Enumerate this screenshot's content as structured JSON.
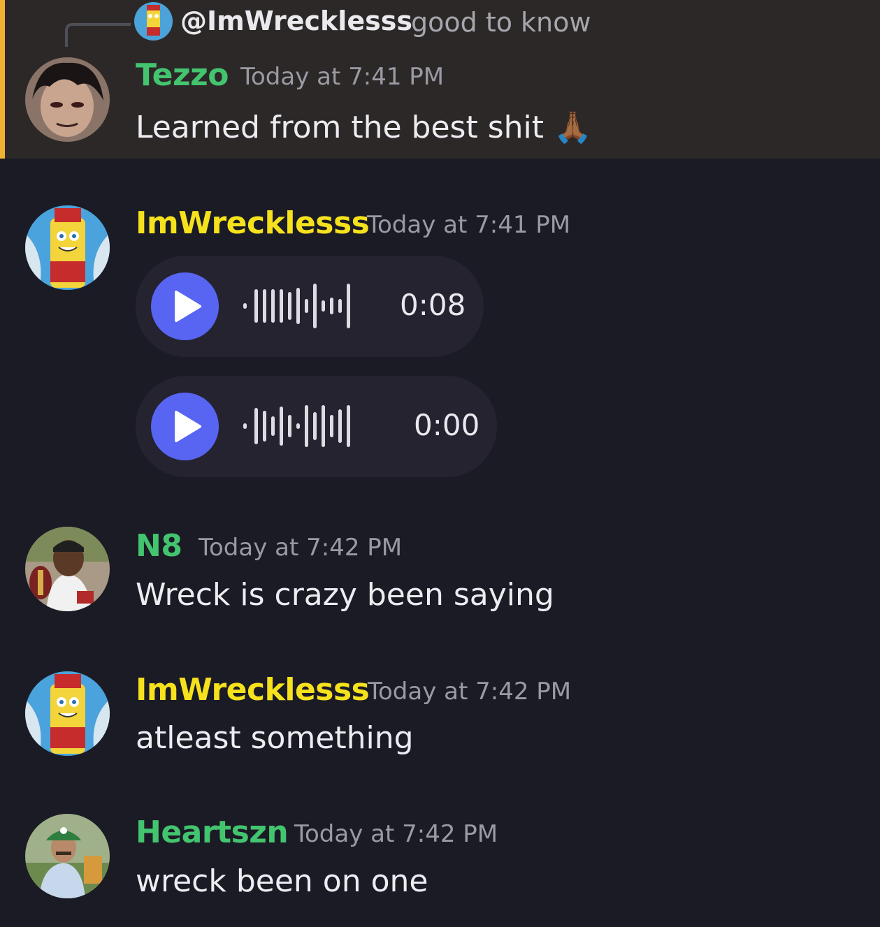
{
  "reply": {
    "mention": "@ImWrecklesss",
    "text": "good to know"
  },
  "messages": [
    {
      "username": "Tezzo",
      "timestamp": "Today at 7:41 PM",
      "text": "Learned from the best shit",
      "emoji": "🙏🏾",
      "name_color": "#43c46f"
    },
    {
      "username": "ImWrecklesss",
      "timestamp": "Today at 7:41 PM",
      "name_color": "#f6e21c",
      "voice_messages": [
        {
          "duration": "0:08"
        },
        {
          "duration": "0:00"
        }
      ]
    },
    {
      "username": "N8",
      "timestamp": "Today at 7:42 PM",
      "text": "Wreck is crazy been saying",
      "name_color": "#43c46f"
    },
    {
      "username": "ImWrecklesss",
      "timestamp": "Today at 7:42 PM",
      "text": "atleast something",
      "name_color": "#f6e21c"
    },
    {
      "username": "Heartszn",
      "timestamp": "Today at 7:42 PM",
      "text": "wreck been on one",
      "name_color": "#43c46f"
    }
  ],
  "colors": {
    "background": "#1b1b25",
    "highlight_background": "#2d2828",
    "highlight_bar": "#f0b232",
    "play_button": "#5865f2",
    "voice_pill": "#24232f"
  },
  "icons": {
    "play": "play-icon",
    "waveform": "waveform-icon"
  }
}
